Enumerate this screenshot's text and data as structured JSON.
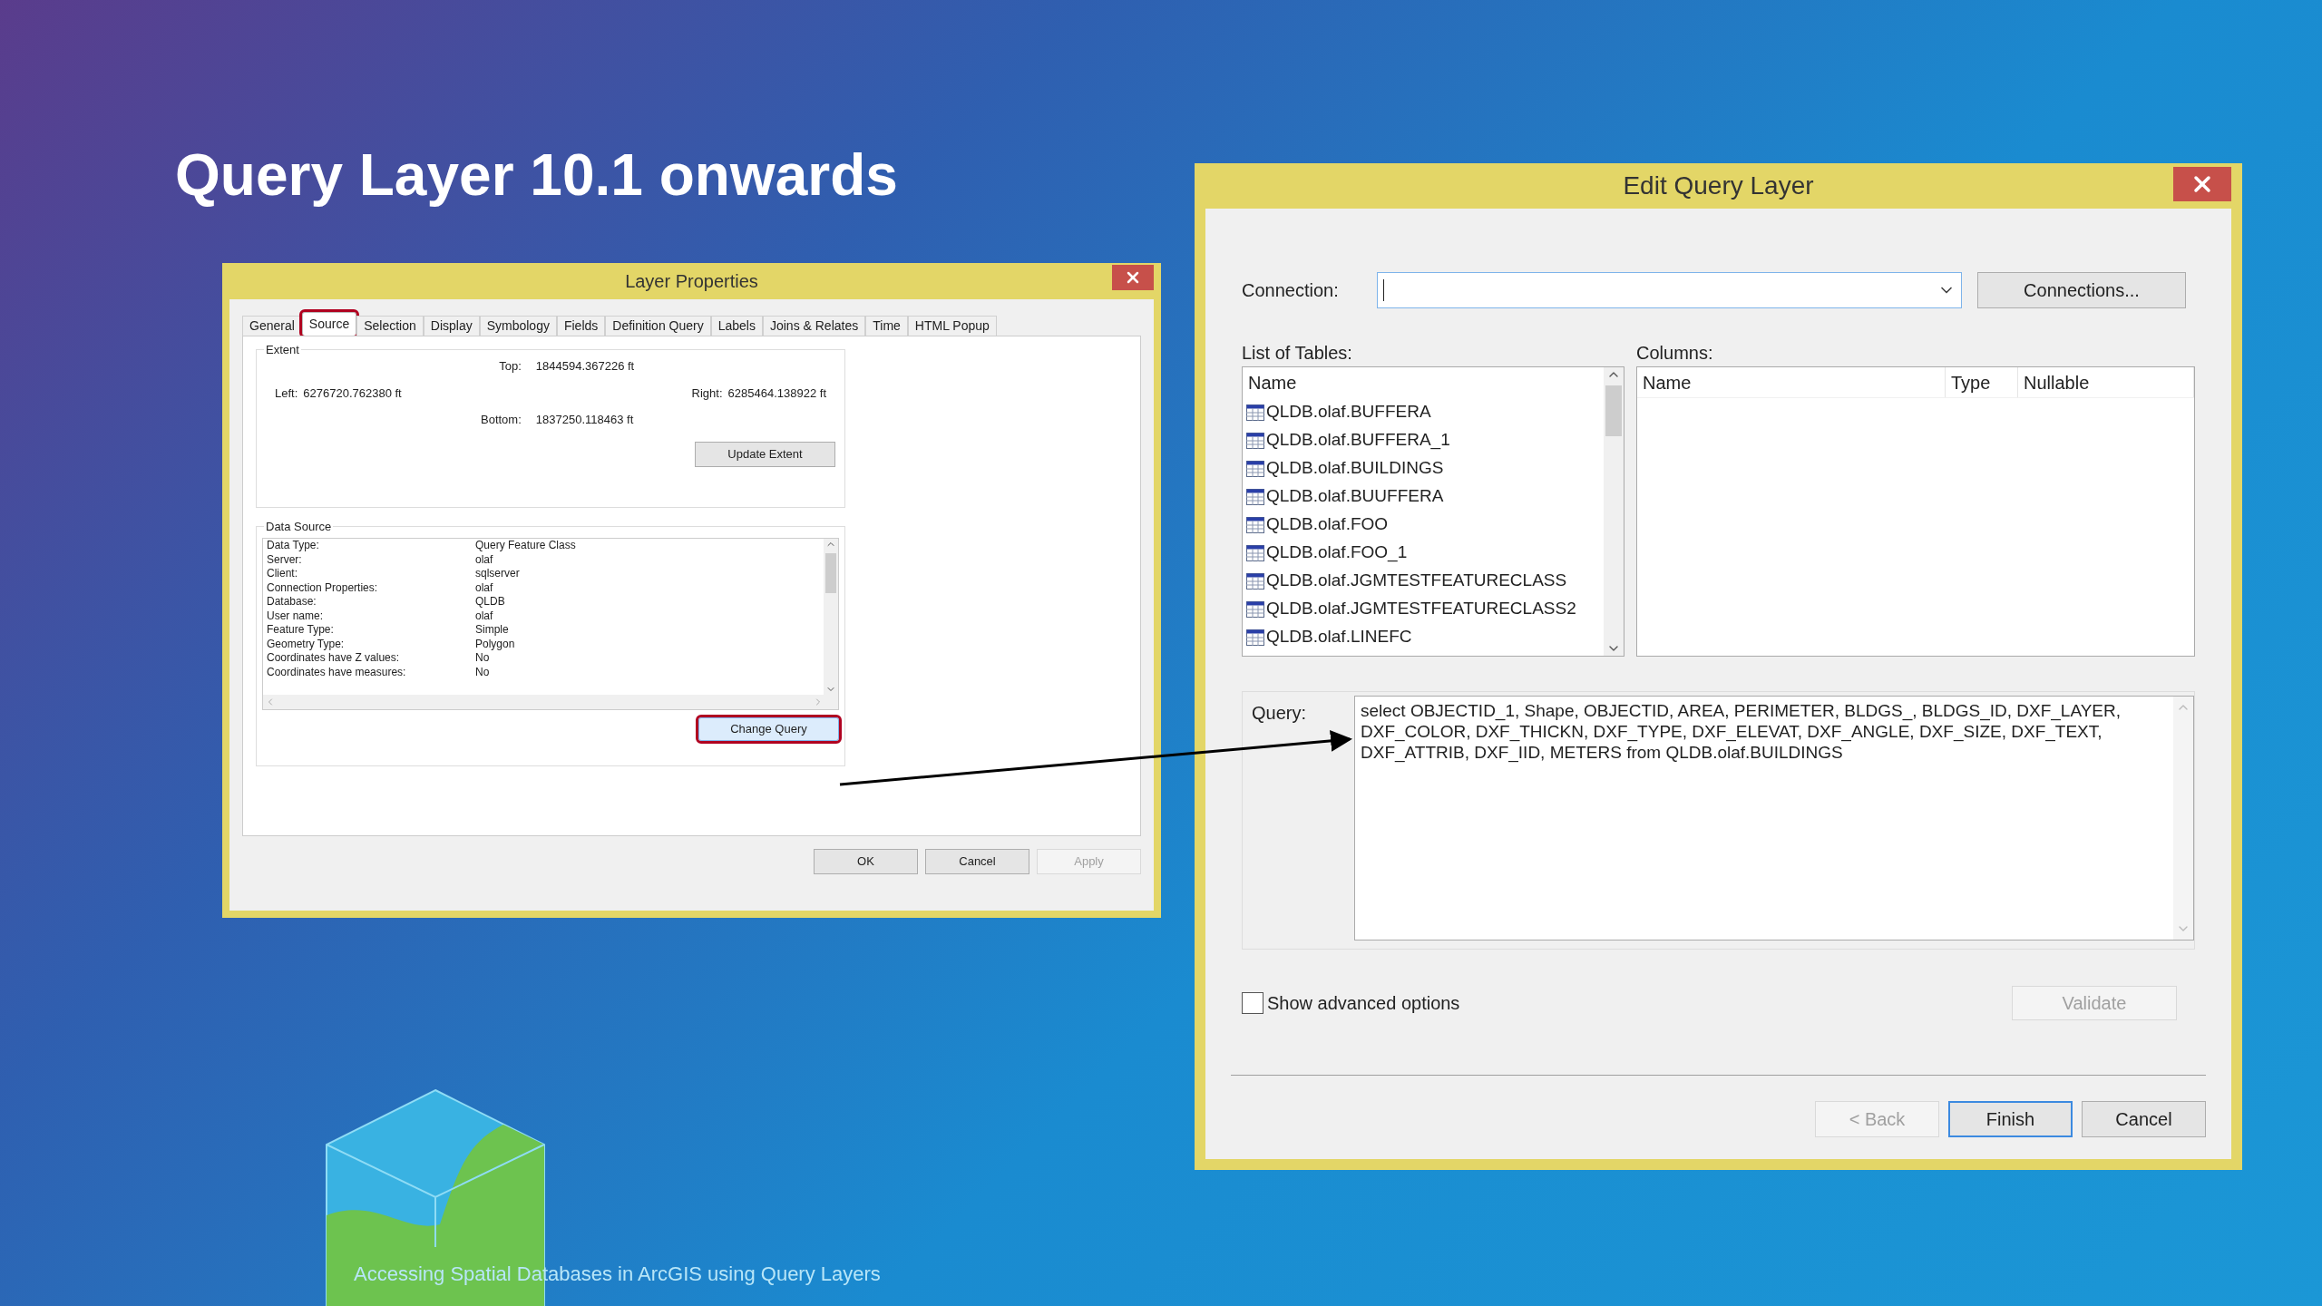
{
  "slide": {
    "title": "Query Layer 10.1 onwards",
    "footer": "Accessing Spatial Databases in ArcGIS using Query Layers"
  },
  "layer_properties": {
    "title": "Layer Properties",
    "tabs": [
      {
        "label": "General",
        "selected": false,
        "circled": false
      },
      {
        "label": "Source",
        "selected": true,
        "circled": true
      },
      {
        "label": "Selection",
        "selected": false,
        "circled": false
      },
      {
        "label": "Display",
        "selected": false,
        "circled": false
      },
      {
        "label": "Symbology",
        "selected": false,
        "circled": false
      },
      {
        "label": "Fields",
        "selected": false,
        "circled": false
      },
      {
        "label": "Definition Query",
        "selected": false,
        "circled": false
      },
      {
        "label": "Labels",
        "selected": false,
        "circled": false
      },
      {
        "label": "Joins & Relates",
        "selected": false,
        "circled": false
      },
      {
        "label": "Time",
        "selected": false,
        "circled": false
      },
      {
        "label": "HTML Popup",
        "selected": false,
        "circled": false
      }
    ],
    "extent": {
      "label": "Extent",
      "top_label": "Top:",
      "top": "1844594.367226 ft",
      "left_label": "Left:",
      "left": "6276720.762380 ft",
      "right_label": "Right:",
      "right": "6285464.138922 ft",
      "bottom_label": "Bottom:",
      "bottom": "1837250.118463 ft",
      "update_button": "Update Extent"
    },
    "data_source": {
      "label": "Data Source",
      "rows": [
        {
          "name": "Data Type:",
          "value": "Query Feature Class"
        },
        {
          "name": "Server:",
          "value": "olaf"
        },
        {
          "name": "Client:",
          "value": "sqlserver"
        },
        {
          "name": "Connection Properties:",
          "value": "olaf"
        },
        {
          "name": "Database:",
          "value": "QLDB"
        },
        {
          "name": "User name:",
          "value": "olaf"
        },
        {
          "name": "Feature Type:",
          "value": "Simple"
        },
        {
          "name": "Geometry Type:",
          "value": "Polygon"
        },
        {
          "name": "Coordinates have Z values:",
          "value": "No"
        },
        {
          "name": "Coordinates have measures:",
          "value": "No"
        }
      ],
      "change_query_button": {
        "label": "Change Query",
        "circled": true
      }
    },
    "buttons": [
      {
        "label": "OK",
        "disabled": false
      },
      {
        "label": "Cancel",
        "disabled": false
      },
      {
        "label": "Apply",
        "disabled": true
      }
    ]
  },
  "edit_query_layer": {
    "title": "Edit Query Layer",
    "connection_label": "Connection:",
    "connections_button": "Connections...",
    "tables_label": "List of Tables:",
    "tables_header": "Name",
    "tables": [
      "QLDB.olaf.BUFFERA",
      "QLDB.olaf.BUFFERA_1",
      "QLDB.olaf.BUILDINGS",
      "QLDB.olaf.BUUFFERA",
      "QLDB.olaf.FOO",
      "QLDB.olaf.FOO_1",
      "QLDB.olaf.JGMTESTFEATURECLASS",
      "QLDB.olaf.JGMTESTFEATURECLASS2",
      "QLDB.olaf.LINEFC"
    ],
    "columns_label": "Columns:",
    "columns_headers": [
      "Name",
      "Type",
      "Nullable"
    ],
    "query_label": "Query:",
    "query": "select OBJECTID_1, Shape, OBJECTID, AREA, PERIMETER, BLDGS_, BLDGS_ID, DXF_LAYER, DXF_COLOR, DXF_THICKN, DXF_TYPE, DXF_ELEVAT, DXF_ANGLE, DXF_SIZE, DXF_TEXT, DXF_ATTRIB, DXF_IID, METERS from QLDB.olaf.BUILDINGS",
    "show_advanced": {
      "label": "Show advanced options",
      "checked": false
    },
    "validate": {
      "label": "Validate",
      "disabled": true
    },
    "buttons": [
      {
        "label": "< Back",
        "disabled": true,
        "default": false
      },
      {
        "label": "Finish",
        "disabled": false,
        "default": true
      },
      {
        "label": "Cancel",
        "disabled": false,
        "default": false
      }
    ]
  }
}
